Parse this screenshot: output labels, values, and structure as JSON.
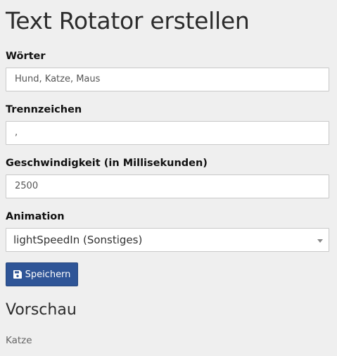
{
  "page": {
    "title": "Text Rotator erstellen"
  },
  "form": {
    "words": {
      "label": "Wörter",
      "value": "Hund, Katze, Maus"
    },
    "separator": {
      "label": "Trennzeichen",
      "value": ","
    },
    "speed": {
      "label": "Geschwindigkeit (in Millisekunden)",
      "value": "2500"
    },
    "animation": {
      "label": "Animation",
      "selected": "lightSpeedIn (Sonstiges)"
    },
    "save_button": {
      "label": "Speichern",
      "icon": "floppy-disk-icon",
      "color": "#2f5597"
    }
  },
  "preview": {
    "title": "Vorschau",
    "text": "Katze"
  }
}
